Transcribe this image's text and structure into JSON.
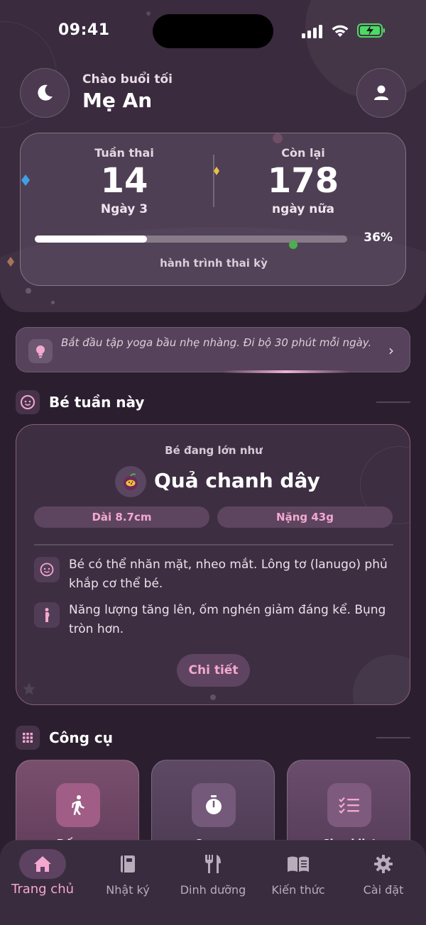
{
  "status_bar": {
    "time": "09:41"
  },
  "header": {
    "greeting": "Chào buổi tối",
    "name": "Mẹ An"
  },
  "pregnancy": {
    "week_label": "Tuần thai",
    "week_value": "14",
    "day_text": "Ngày 3",
    "remaining_label": "Còn lại",
    "remaining_value": "178",
    "remaining_unit": "ngày nữa",
    "progress_percent": 36,
    "progress_text": "36%",
    "progress_caption": "hành trình thai kỳ"
  },
  "tip": {
    "text": "Bắt đầu tập yoga bầu nhẹ nhàng. Đi bộ 30 phút mỗi ngày."
  },
  "baby_section": {
    "title": "Bé tuần này",
    "size_label": "Bé đang lớn như",
    "fruit": "Quả chanh dây",
    "length": "Dài 8.7cm",
    "weight": "Nặng 43g",
    "facts": [
      {
        "icon": "baby-face-icon",
        "text": "Bé có thể nhăn mặt, nheo mắt. Lông tơ (lanugo) phủ khắp cơ thể bé."
      },
      {
        "icon": "pregnant-woman-icon",
        "text": "Năng lượng tăng lên, ốm nghén giảm đáng kể. Bụng tròn hơn."
      }
    ],
    "detail_button": "Chi tiết"
  },
  "tools_section": {
    "title": "Công cụ",
    "items": [
      {
        "icon": "walking-icon",
        "label": "Đếm ..."
      },
      {
        "icon": "timer-icon",
        "label": "Cơn ..."
      },
      {
        "icon": "checklist-icon",
        "label": "Checklist"
      }
    ]
  },
  "bottom_nav": {
    "items": [
      {
        "icon": "home-icon",
        "label": "Trang chủ",
        "active": true
      },
      {
        "icon": "diary-icon",
        "label": "Nhật ký",
        "active": false
      },
      {
        "icon": "nutrition-icon",
        "label": "Dinh dưỡng",
        "active": false
      },
      {
        "icon": "knowledge-icon",
        "label": "Kiến thức",
        "active": false
      },
      {
        "icon": "settings-icon",
        "label": "Cài đặt",
        "active": false
      }
    ]
  },
  "colors": {
    "background": "#2b1f2f",
    "accent_pink": "#f4a8cf",
    "progress_dot": "#4caf50"
  }
}
